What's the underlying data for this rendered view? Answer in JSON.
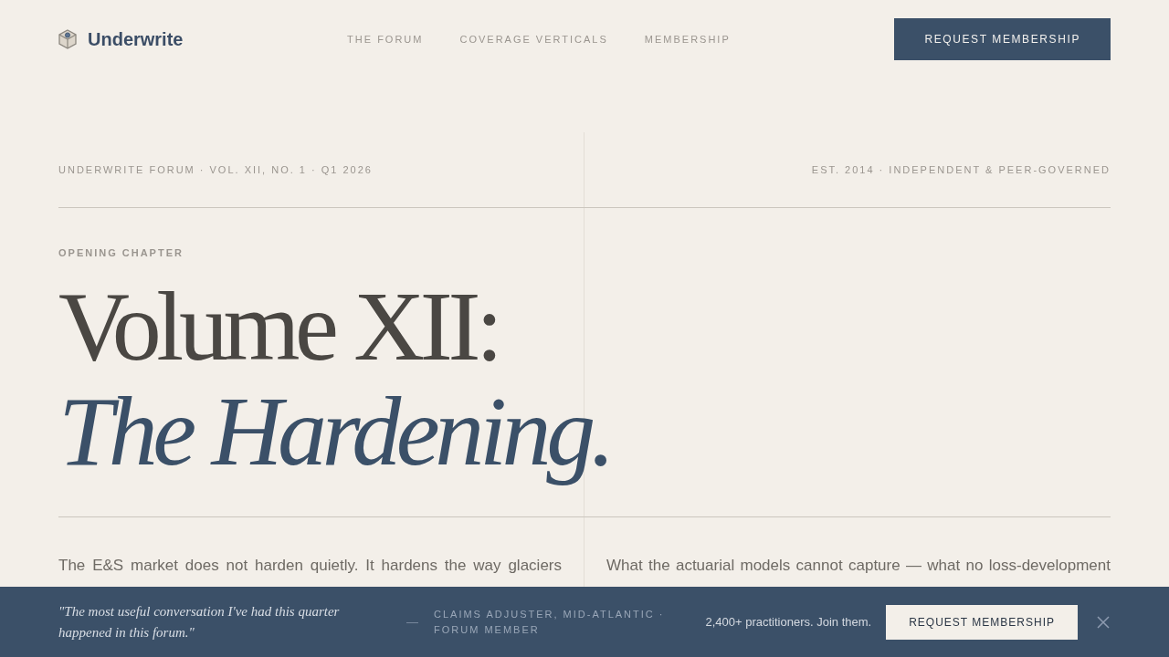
{
  "header": {
    "logo": "Underwrite",
    "nav": [
      "THE FORUM",
      "COVERAGE VERTICALS",
      "MEMBERSHIP"
    ],
    "cta": "REQUEST MEMBERSHIP"
  },
  "masthead": {
    "left": "UNDERWRITE FORUM · VOL. XII, NO. 1 · Q1 2026",
    "right": "EST. 2014 · INDEPENDENT & PEER-GOVERNED"
  },
  "hero": {
    "eyebrow": "OPENING CHAPTER",
    "title": "Volume XII:",
    "subtitle": "The Hardening."
  },
  "body": {
    "columns": [
      "The E&S market does not harden quietly. It hardens the way glaciers",
      "What the actuarial models cannot capture — what no loss-development"
    ]
  },
  "promo_bar": {
    "quote": "\"The most useful conversation I've had this quarter happened in this forum.\"",
    "dash": "—",
    "attribution": "CLAIMS ADJUSTER, MID-ATLANTIC · FORUM MEMBER",
    "social_proof": "2,400+ practitioners. Join them.",
    "cta": "REQUEST MEMBERSHIP"
  }
}
